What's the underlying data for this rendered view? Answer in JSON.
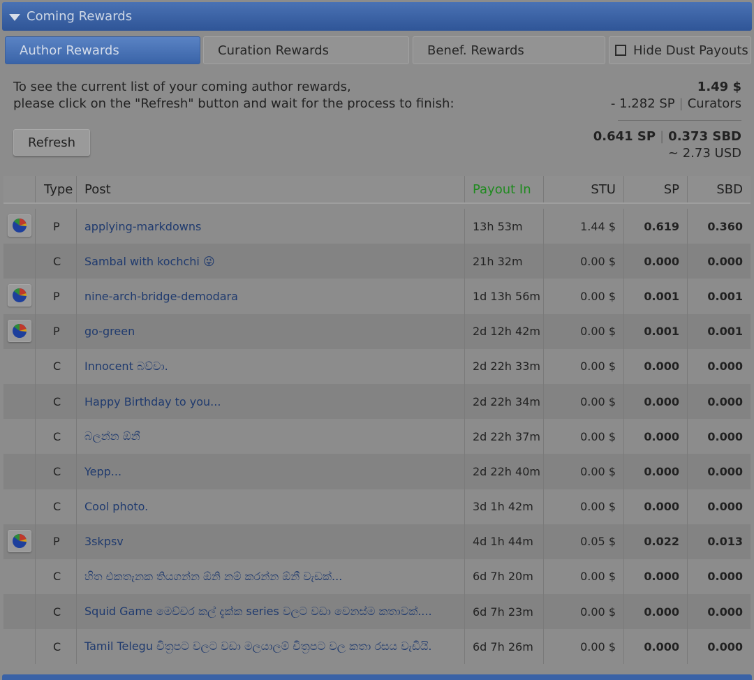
{
  "panel": {
    "title": "Coming Rewards"
  },
  "tabs": {
    "author": "Author Rewards",
    "curation": "Curation Rewards",
    "benef": "Benef. Rewards",
    "hide_dust": "Hide Dust Payouts"
  },
  "info": {
    "line1": "To see the current list of your coming author rewards,",
    "line2": "please click on the \"Refresh\" button and wait for the process to finish:",
    "total_usd": "1.49 $",
    "curators_sp": "- 1.282 SP",
    "curators_label": "Curators",
    "sp_total": "0.641 SP",
    "sbd_total": "0.373 SBD",
    "usd_approx": "~ 2.73 USD"
  },
  "refresh_label": "Refresh",
  "table": {
    "headers": {
      "type": "Type",
      "post": "Post",
      "payout": "Payout In",
      "stu": "STU",
      "sp": "SP",
      "sbd": "SBD"
    },
    "rows": [
      {
        "pie": true,
        "type": "P",
        "post": "applying-markdowns",
        "payout": "13h 53m",
        "stu": "1.44 $",
        "sp": "0.619",
        "sbd": "0.360"
      },
      {
        "pie": false,
        "type": "C",
        "post": "Sambal with kochchi 😜",
        "payout": "21h 32m",
        "stu": "0.00 $",
        "sp": "0.000",
        "sbd": "0.000"
      },
      {
        "pie": true,
        "type": "P",
        "post": "nine-arch-bridge-demodara",
        "payout": "1d 13h 56m",
        "stu": "0.00 $",
        "sp": "0.001",
        "sbd": "0.001"
      },
      {
        "pie": true,
        "type": "P",
        "post": "go-green",
        "payout": "2d 12h 42m",
        "stu": "0.00 $",
        "sp": "0.001",
        "sbd": "0.001"
      },
      {
        "pie": false,
        "type": "C",
        "post": "Innocent බව්වා.",
        "payout": "2d 22h 33m",
        "stu": "0.00 $",
        "sp": "0.000",
        "sbd": "0.000"
      },
      {
        "pie": false,
        "type": "C",
        "post": "Happy Birthday to you...",
        "payout": "2d 22h 34m",
        "stu": "0.00 $",
        "sp": "0.000",
        "sbd": "0.000"
      },
      {
        "pie": false,
        "type": "C",
        "post": "බලන්න ඕනී",
        "payout": "2d 22h 37m",
        "stu": "0.00 $",
        "sp": "0.000",
        "sbd": "0.000"
      },
      {
        "pie": false,
        "type": "C",
        "post": "Yepp...",
        "payout": "2d 22h 40m",
        "stu": "0.00 $",
        "sp": "0.000",
        "sbd": "0.000"
      },
      {
        "pie": false,
        "type": "C",
        "post": "Cool photo.",
        "payout": "3d 1h 42m",
        "stu": "0.00 $",
        "sp": "0.000",
        "sbd": "0.000"
      },
      {
        "pie": true,
        "type": "P",
        "post": "3skpsv",
        "payout": "4d 1h 44m",
        "stu": "0.05 $",
        "sp": "0.022",
        "sbd": "0.013"
      },
      {
        "pie": false,
        "type": "C",
        "post": "හිත එකතැනක තියගන්න ඕනි නම් කරන්න ඕනී වැඩක්...",
        "payout": "6d 7h 20m",
        "stu": "0.00 $",
        "sp": "0.000",
        "sbd": "0.000"
      },
      {
        "pie": false,
        "type": "C",
        "post": "Squid Game මෙච්චර කල් දැක්ක series වලට වඩා වෙනස්ම කතාවක්....",
        "payout": "6d 7h 23m",
        "stu": "0.00 $",
        "sp": "0.000",
        "sbd": "0.000"
      },
      {
        "pie": false,
        "type": "C",
        "post": "Tamil Telegu චිත්‍රපට වලට වඩා මලයාලම් චිත්‍රපට වල කතා රසය වැඩියි.",
        "payout": "6d 7h 26m",
        "stu": "0.00 $",
        "sp": "0.000",
        "sbd": "0.000"
      }
    ]
  },
  "colors": {
    "header_blue": "#3a62a6",
    "payout_header": "#1f8a1f",
    "link": "#1f3a6e",
    "pie_blue": "#1d3f9c",
    "pie_red": "#c0392b",
    "pie_green": "#2e8b3a",
    "pie_yellow": "#d4a017"
  }
}
